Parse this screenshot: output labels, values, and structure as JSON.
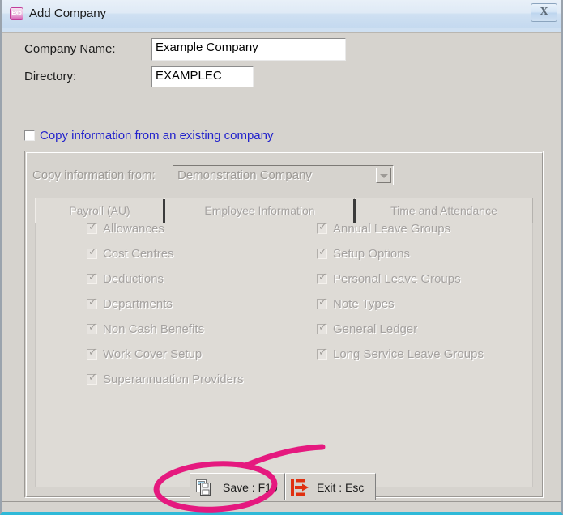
{
  "window": {
    "title": "Add Company",
    "app_icon_text": "Exo",
    "close_label": "✕",
    "close_glyph": "X"
  },
  "form": {
    "company_name_label": "Company Name:",
    "company_name_value": "Example Company",
    "directory_label": "Directory:",
    "directory_value": "EXAMPLEC",
    "copy_existing_label": "Copy information from an existing company",
    "copy_existing_checked": false
  },
  "group": {
    "copy_from_label": "Copy information from:",
    "copy_from_selected": "Demonstration Company",
    "copy_from_options": [
      "Demonstration Company"
    ],
    "enabled": false
  },
  "tabs": [
    {
      "label": "Payroll (AU)",
      "active": true
    },
    {
      "label": "Employee Information",
      "active": false
    },
    {
      "label": "Time and Attendance",
      "active": false
    }
  ],
  "options": {
    "left_column": [
      {
        "label": "Allowances",
        "checked": true
      },
      {
        "label": "Cost Centres",
        "checked": true
      },
      {
        "label": "Deductions",
        "checked": true
      },
      {
        "label": "Departments",
        "checked": true
      },
      {
        "label": "Non Cash Benefits",
        "checked": true
      },
      {
        "label": "Work Cover Setup",
        "checked": true
      },
      {
        "label": "Superannuation Providers",
        "checked": true
      }
    ],
    "right_column": [
      {
        "label": "Annual Leave Groups",
        "checked": true
      },
      {
        "label": "Setup Options",
        "checked": true
      },
      {
        "label": "Personal Leave Groups",
        "checked": true
      },
      {
        "label": "Note Types",
        "checked": true
      },
      {
        "label": "General Ledger",
        "checked": true
      },
      {
        "label": "Long Service Leave Groups",
        "checked": true
      }
    ]
  },
  "buttons": {
    "save_label": "Save : F10",
    "exit_label": "Exit : Esc"
  },
  "annotation": {
    "color": "#e5197f",
    "shape": "ellipse-highlight-around-save-button"
  },
  "colors": {
    "window_background": "#d6d3ce",
    "titlebar_gradient_top": "#e8f0f8",
    "titlebar_gradient_bottom": "#c4d9ef",
    "link_text": "#2222cc",
    "disabled_text": "#a5a2a0",
    "bottom_border": "#2fb9d8",
    "annotation_pink": "#e5197f",
    "exit_icon_red": "#e03010"
  }
}
